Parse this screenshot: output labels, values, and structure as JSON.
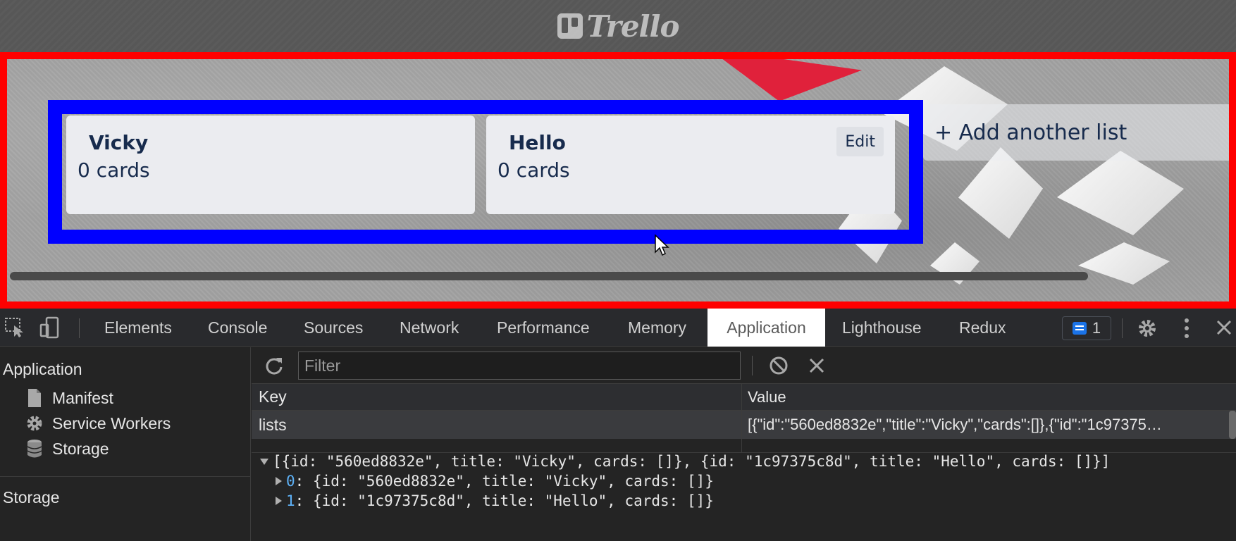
{
  "app": {
    "logo_text": "Trello"
  },
  "board": {
    "lists": [
      {
        "title": "Vicky",
        "count": "0 cards"
      },
      {
        "title": "Hello",
        "count": "0 cards",
        "edit_label": "Edit"
      }
    ],
    "add_list_label": "+ Add another list"
  },
  "devtools": {
    "tabs": [
      "Elements",
      "Console",
      "Sources",
      "Network",
      "Performance",
      "Memory",
      "Application",
      "Lighthouse",
      "Redux"
    ],
    "active_tab": "Application",
    "issues_count": "1",
    "sidebar": {
      "application_heading": "Application",
      "items": [
        "Manifest",
        "Service Workers",
        "Storage"
      ],
      "storage_heading": "Storage"
    },
    "filter": {
      "placeholder": "Filter"
    },
    "table": {
      "headers": {
        "key": "Key",
        "value": "Value"
      },
      "rows": [
        {
          "key": "lists",
          "value": "[{\"id\":\"560ed8832e\",\"title\":\"Vicky\",\"cards\":[]},{\"id\":\"1c97375…"
        }
      ]
    },
    "preview": {
      "summary": "[{id: \"560ed8832e\", title: \"Vicky\", cards: []}, {id: \"1c97375c8d\", title: \"Hello\", cards: []}]",
      "items": [
        {
          "index": "0",
          "text": ": {id: \"560ed8832e\", title: \"Vicky\", cards: []}"
        },
        {
          "index": "1",
          "text": ": {id: \"1c97375c8d\", title: \"Hello\", cards: []}"
        }
      ]
    }
  },
  "colors": {
    "board_outline": "#ff0000",
    "lists_outline": "#0000ff",
    "active_tab_bg": "#ffffff",
    "badge": "#1a73e8"
  }
}
